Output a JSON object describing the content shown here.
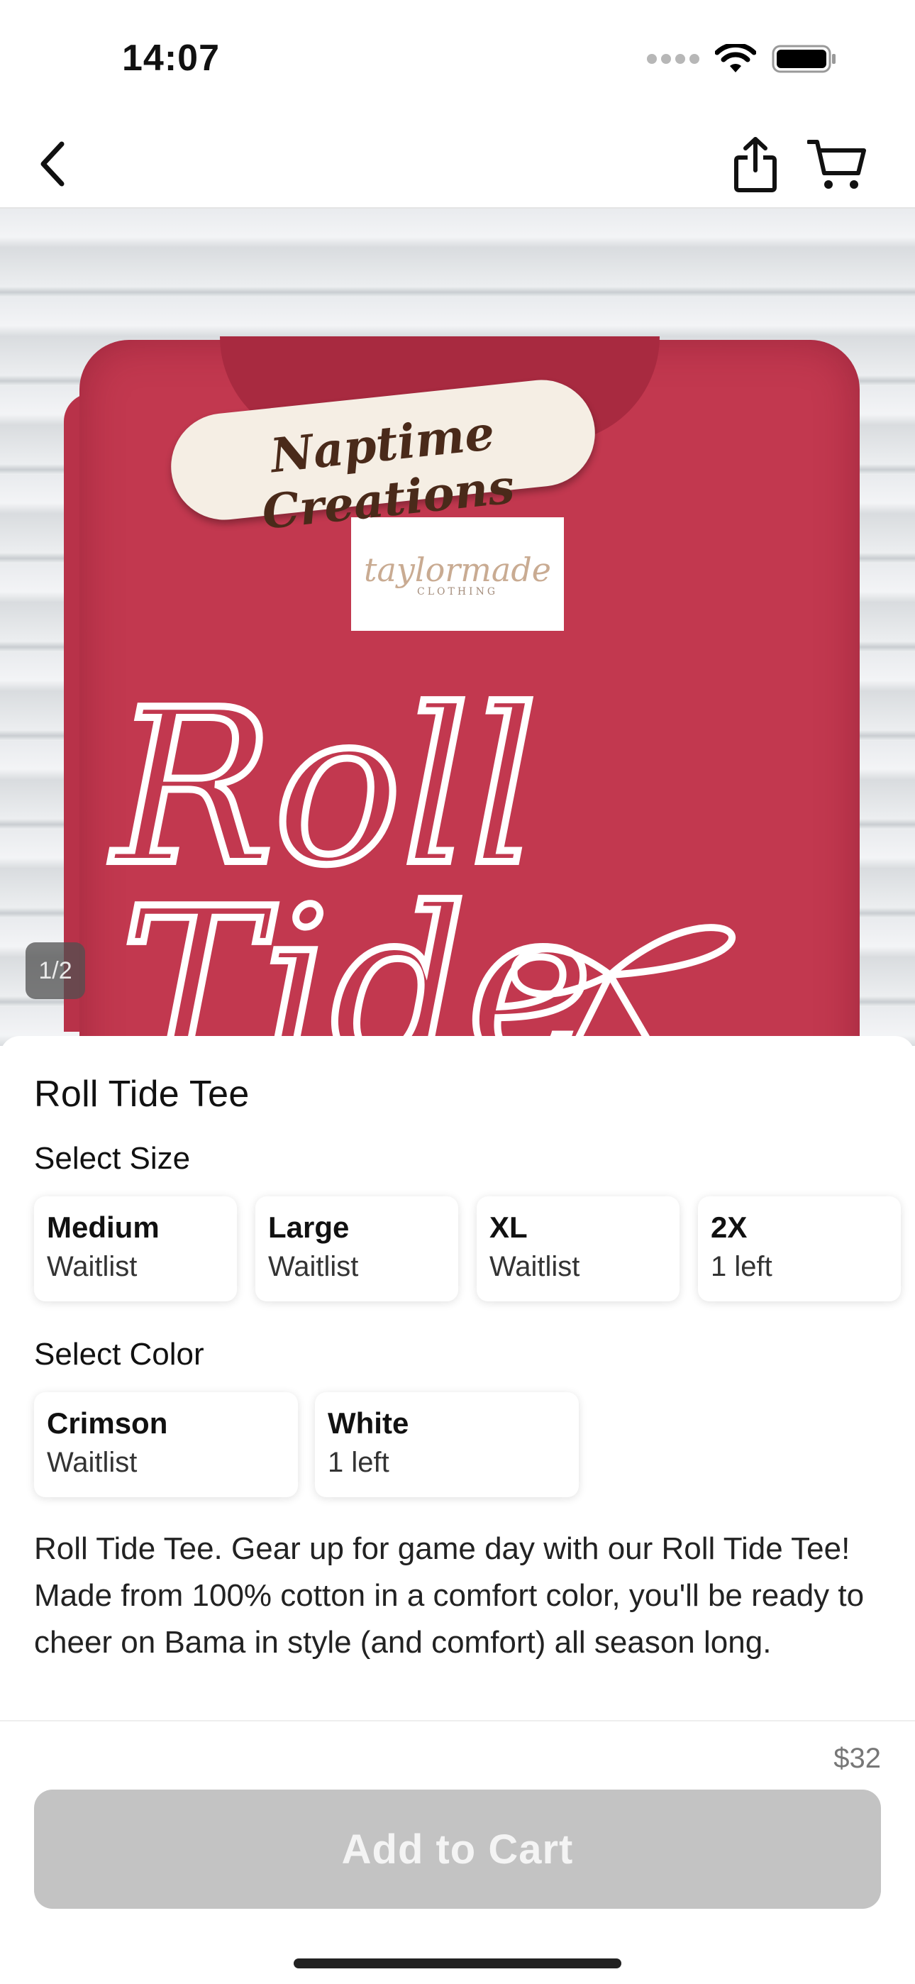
{
  "status_bar": {
    "time": "14:07",
    "icons": [
      "signal-icon",
      "wifi-icon",
      "battery-icon"
    ]
  },
  "nav": {
    "back_icon": "chevron-left-icon",
    "share_icon": "share-icon",
    "cart_icon": "cart-icon"
  },
  "gallery": {
    "page_indicator": "1/2",
    "sticker_text": "Naptime Creations",
    "label_brand": "taylormade",
    "label_sub": "CLOTHING",
    "shirt_text_line1": "Roll",
    "shirt_text_line2": "Tide"
  },
  "product": {
    "title": "Roll Tide Tee",
    "size_label": "Select Size",
    "sizes": [
      {
        "name": "Medium",
        "status": "Waitlist"
      },
      {
        "name": "Large",
        "status": "Waitlist"
      },
      {
        "name": "XL",
        "status": "Waitlist"
      },
      {
        "name": "2X",
        "status": "1 left"
      }
    ],
    "color_label": "Select Color",
    "colors": [
      {
        "name": "Crimson",
        "status": "Waitlist"
      },
      {
        "name": "White",
        "status": "1 left"
      }
    ],
    "description": "Roll Tide Tee. Gear up for game day with our Roll Tide Tee! Made from 100% cotton in a comfort color, you'll be ready to cheer on Bama in style (and comfort) all season long."
  },
  "bottom": {
    "price": "$32",
    "add_to_cart": "Add to Cart"
  },
  "colors": {
    "shirt": "#c2384f",
    "button_disabled": "#c3c3c3",
    "page_indicator_bg": "#505050"
  }
}
